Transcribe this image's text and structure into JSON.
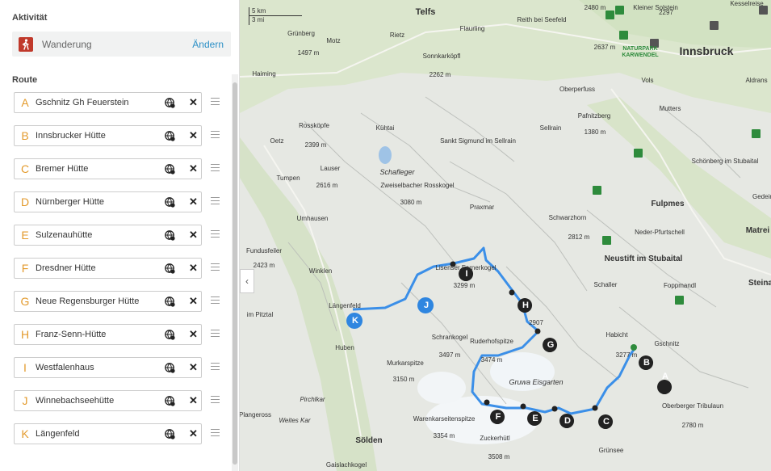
{
  "activity": {
    "heading": "Aktivität",
    "name": "Wanderung",
    "change_label": "Ändern"
  },
  "route": {
    "heading": "Route",
    "stops": [
      {
        "letter": "A",
        "name": "Gschnitz Gh Feuerstein"
      },
      {
        "letter": "B",
        "name": "Innsbrucker Hütte"
      },
      {
        "letter": "C",
        "name": "Bremer Hütte"
      },
      {
        "letter": "D",
        "name": "Nürnberger Hütte"
      },
      {
        "letter": "E",
        "name": "Sulzenauhütte"
      },
      {
        "letter": "F",
        "name": "Dresdner Hütte"
      },
      {
        "letter": "G",
        "name": "Neue Regensburger Hütte"
      },
      {
        "letter": "H",
        "name": "Franz-Senn-Hütte"
      },
      {
        "letter": "I",
        "name": "Westfalenhaus"
      },
      {
        "letter": "J",
        "name": "Winnebachseehütte"
      },
      {
        "letter": "K",
        "name": "Längenfeld"
      }
    ]
  },
  "map": {
    "scale_km": "5 km",
    "scale_mi": "3 mi",
    "labels": [
      "Telfs",
      "Innsbruck",
      "Flaurling",
      "Reith bei Seefeld",
      "Kleiner Solstein",
      "2480 m",
      "2297",
      "2637 m",
      "NATURPARK",
      "KARWENDEL",
      "Grünberg",
      "1497 m",
      "Rietz",
      "Motz",
      "Sonnkarköpfl",
      "2262 m",
      "Haiming",
      "Vols",
      "Aldrans",
      "Oberperfuss",
      "Mutters",
      "Sellrain",
      "Pafnitzberg",
      "1380 m",
      "Kühtai",
      "Oetz",
      "Rossköpfe",
      "2399 m",
      "Sankt Sigmund im Sellrain",
      "Schönberg im Stubaital",
      "Lauser",
      "2616 m",
      "Tumpen",
      "Schafleger",
      "Zweiselbacher Rosskogel",
      "3080 m",
      "Gedeir",
      "Fulpmes",
      "Praxmar",
      "Umhausen",
      "Schwarzhorn",
      "2812 m",
      "Neder-Pfurtschell",
      "Matrei am Br",
      "Fundusfeiler",
      "2423 m",
      "Neustift im Stubaital",
      "Steinach a",
      "Winklen",
      "Lisenser Fernerkogel",
      "3299 m",
      "Schaller",
      "Foppmandl",
      "2907",
      "Längenfeld",
      "im Pitztal",
      "Habicht",
      "3277 m",
      "Gschnitz",
      "Schrankogel",
      "3497 m",
      "Ruderhofspitze",
      "3474 m",
      "Huben",
      "Murkarspitze",
      "3150 m",
      "Gruwa Eisgarten",
      "Oberberger Tribulaun",
      "2780 m",
      "Pirchlkar",
      "Weites Kar",
      "Plangeross",
      "Warenkarseitenspitze",
      "3354 m",
      "Sölden",
      "Zuckerhütl",
      "3508 m",
      "Grünsee",
      "Gaislachkogel",
      "Kesselreise"
    ]
  },
  "colors": {
    "accent": "#e39a2c",
    "link": "#2a8fc6",
    "hiker": "#c0392b",
    "route": "#3b8fe8",
    "hut": "#2e8b3c",
    "marker_dark": "#222222",
    "marker_blue": "#2f86e0"
  }
}
